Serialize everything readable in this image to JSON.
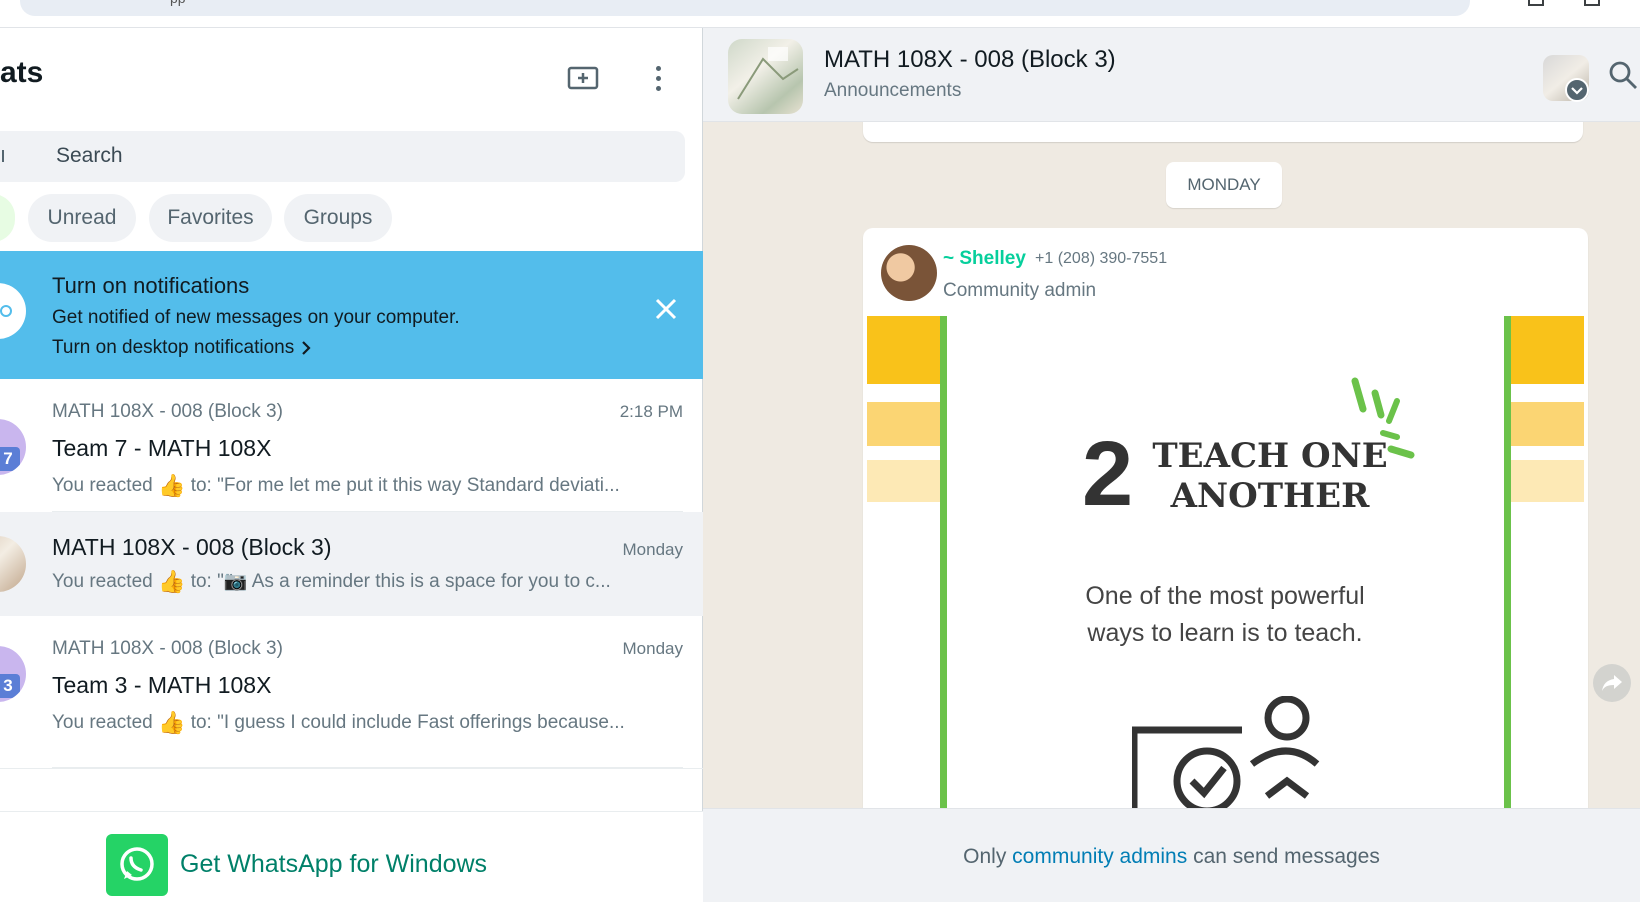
{
  "browser": {
    "address_partial": "pp"
  },
  "sidebar": {
    "title": "ats",
    "search_placeholder": "Search",
    "filters": [
      "Unread",
      "Favorites",
      "Groups"
    ],
    "notification": {
      "title": "Turn on notifications",
      "body": "Get notified of new messages on your computer.",
      "link": "Turn on desktop notifications"
    },
    "chats": [
      {
        "community": "MATH 108X - 008 (Block 3)",
        "time": "2:18 PM",
        "name": "Team 7 - MATH 108X",
        "badge": "7",
        "preview_prefix": "You reacted",
        "preview_emoji": "👍",
        "preview_text": "to: \"For me let me put it this way Standard deviati..."
      },
      {
        "time": "Monday",
        "name": "MATH 108X - 008 (Block 3)",
        "preview_prefix": "You reacted",
        "preview_emoji": "👍",
        "preview_text": "to: \"📷 As a reminder this is a space for you to c..."
      },
      {
        "community": "MATH 108X - 008 (Block 3)",
        "time": "Monday",
        "name": "Team 3 - MATH 108X",
        "badge": "3",
        "preview_prefix": "You reacted",
        "preview_emoji": "👍",
        "preview_text": "to: \"I guess I could include Fast offerings because..."
      }
    ],
    "get_app": "Get WhatsApp for Windows"
  },
  "conversation": {
    "title": "MATH 108X - 008 (Block 3)",
    "subtitle": "Announcements",
    "date_divider": "MONDAY",
    "message": {
      "sender": "~ Shelley",
      "phone": "+1 (208) 390-7551",
      "role": "Community admin",
      "image": {
        "number": "2",
        "title_line1": "TEACH ONE",
        "title_line2": "ANOTHER",
        "body_line1": "One of the most powerful",
        "body_line2": "ways to learn is to teach."
      }
    },
    "footer": {
      "prefix": "Only",
      "link": "community admins",
      "suffix": "can send messages"
    }
  },
  "colors": {
    "wa_green": "#25d366",
    "teal_text": "#008069",
    "banner_blue": "#53bdeb",
    "chat_bg": "#efeae2",
    "admin_name": "#06cf9c",
    "link_blue": "#027eb5",
    "image_yellow": "#f9c21a",
    "image_green": "#6bc24a"
  }
}
